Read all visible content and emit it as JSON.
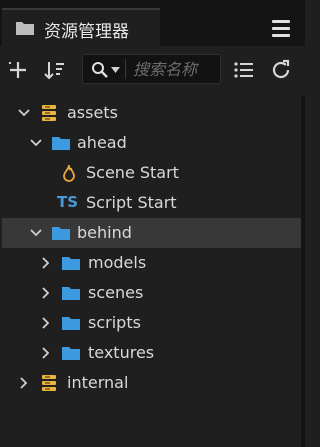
{
  "panel": {
    "title": "资源管理器",
    "menu_icon": "hamburger-menu-icon"
  },
  "toolbar": {
    "add_icon": "plus-icon",
    "sort_icon": "sort-icon",
    "search_icon": "search-icon",
    "search_placeholder": "搜索名称",
    "collapse_icon": "list-icon",
    "refresh_icon": "refresh-icon"
  },
  "tree": {
    "assets": "assets",
    "ahead": "ahead",
    "scene_start": "Scene Start",
    "script_badge": "TS",
    "script_start": "Script Start",
    "behind": "behind",
    "models": "models",
    "scenes": "scenes",
    "scripts": "scripts",
    "textures": "textures",
    "internal": "internal"
  },
  "colors": {
    "folder": "#3d9ae0",
    "db": "#e9b43c",
    "scene": "#e9a83c",
    "ts": "#4a9ad8",
    "selected_row": "#383838"
  }
}
